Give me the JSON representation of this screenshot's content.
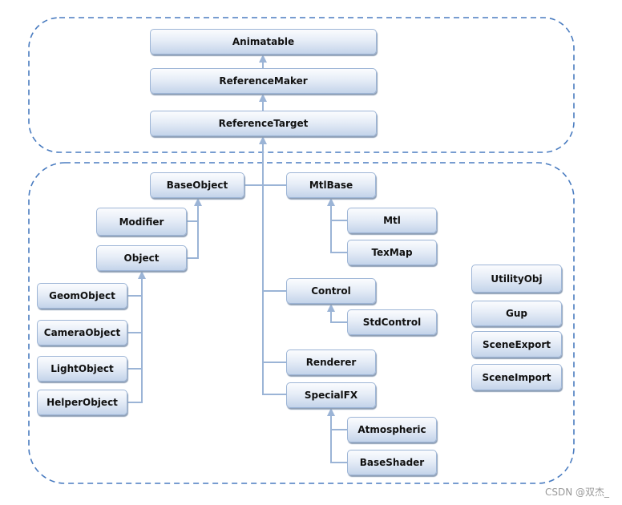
{
  "nodes": {
    "animatable": "Animatable",
    "referencemaker": "ReferenceMaker",
    "referencetarget": "ReferenceTarget",
    "baseobject": "BaseObject",
    "mtlbase": "MtlBase",
    "modifier": "Modifier",
    "object": "Object",
    "mtl": "Mtl",
    "texmap": "TexMap",
    "geomobject": "GeomObject",
    "cameraobject": "CameraObject",
    "lightobject": "LightObject",
    "helperobject": "HelperObject",
    "control": "Control",
    "stdcontrol": "StdControl",
    "renderer": "Renderer",
    "specialfx": "SpecialFX",
    "atmospheric": "Atmospheric",
    "baseshader": "BaseShader",
    "utilityobj": "UtilityObj",
    "gup": "Gup",
    "sceneexport": "SceneExport",
    "sceneimport": "SceneImport"
  },
  "edges": [
    [
      "referencemaker",
      "animatable"
    ],
    [
      "referencetarget",
      "referencemaker"
    ],
    [
      "baseobject",
      "referencetarget"
    ],
    [
      "mtlbase",
      "referencetarget"
    ],
    [
      "control",
      "referencetarget"
    ],
    [
      "renderer",
      "referencetarget"
    ],
    [
      "specialfx",
      "referencetarget"
    ],
    [
      "modifier",
      "baseobject"
    ],
    [
      "object",
      "baseobject"
    ],
    [
      "geomobject",
      "object"
    ],
    [
      "cameraobject",
      "object"
    ],
    [
      "lightobject",
      "object"
    ],
    [
      "helperobject",
      "object"
    ],
    [
      "mtl",
      "mtlbase"
    ],
    [
      "texmap",
      "mtlbase"
    ],
    [
      "stdcontrol",
      "control"
    ],
    [
      "atmospheric",
      "specialfx"
    ],
    [
      "baseshader",
      "specialfx"
    ]
  ],
  "colors": {
    "line": "#9bb4d6",
    "dash": "#4a7cc0"
  },
  "watermark": "CSDN @双杰_"
}
